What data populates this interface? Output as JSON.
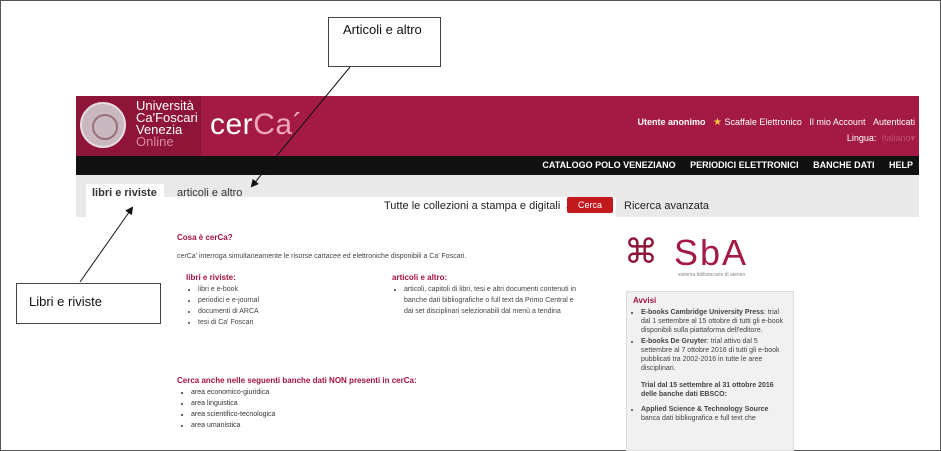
{
  "annotations": {
    "top_callout": "Articoli e altro",
    "bottom_callout": "Libri e riviste"
  },
  "header": {
    "university_lines": [
      "Università",
      "Ca'Foscari",
      "Venezia",
      "Online"
    ],
    "brand_prefix": "cer",
    "brand_suffix": "Ca´",
    "top_links": [
      "Utente anonimo",
      "Scaffale Elettronico",
      "Il mio Account",
      "Autenticati"
    ],
    "lingua_label": "Lingua:",
    "lingua_value": "Italiano",
    "black_nav": [
      "CATALOGO POLO VENEZIANO",
      "PERIODICI ELETTRONICI",
      "BANCHE DATI",
      "HELP"
    ]
  },
  "search": {
    "tab_active": "libri e riviste",
    "tab_other": "articoli e altro",
    "collection": "Tutte le collezioni a stampa e digitali",
    "button": "Cerca",
    "advanced": "Ricerca avanzata"
  },
  "main": {
    "cosa_title": "Cosa è cerCa?",
    "intro": "cerCa' interroga simultaneamente le risorse cartacee ed elettroniche disponibili a Ca' Foscari.",
    "col1_title": "libri e riviste:",
    "col1_items": [
      "libri e e-book",
      "periodici e e-journal",
      "documenti di ARCA",
      "tesi di Ca' Foscari"
    ],
    "col2_title": "articoli e altro:",
    "col2_text": "articoli, capitoli di libri, tesi e altri documenti contenuti in banche dati bibliografiche o full text da Primo Central e dai set disciplinari selezionabili dal menù a tendina",
    "anche_title": "Cerca anche nelle seguenti banche dati NON presenti in cerCa:",
    "anche_items": [
      "area economico-giuridica",
      "area linguistica",
      "area scientifico-tecnologica",
      "area umanistica"
    ]
  },
  "sidebar": {
    "sba_logo": "SbA",
    "sba_sub": "sistema bibliotecario di ateneo",
    "avvisi_title": "Avvisi",
    "avvisi": [
      {
        "bold": "E-books Cambridge University Press",
        "text": ": trial dal 1 settembre al 15 ottobre di tutti gli e-book disponibili sulla piattaforma dell'editore."
      },
      {
        "bold": "E-books De Gruyter",
        "text": ": trial attivo dal 5 settembre al 7 ottobre 2016 di tutti gli e-book pubblicati tra 2002-2016 in tutte le aree disciplinari."
      }
    ],
    "trial_text": "Trial dal 15 settembre al 31 ottobre 2016 delle banche dati EBSCO:",
    "avvisi_last_bold": "Applied Science & Technology Source",
    "avvisi_last_text": "banca dati bibliografica e full text che"
  }
}
